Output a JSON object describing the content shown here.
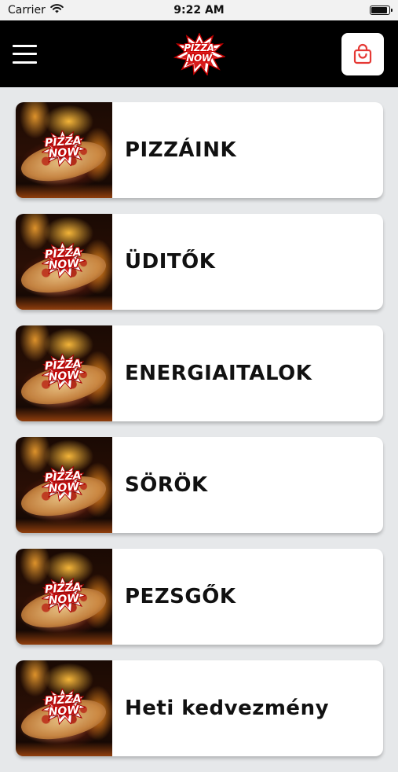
{
  "status_bar": {
    "carrier": "Carrier",
    "time": "9:22 AM"
  },
  "header": {
    "menu_icon": "hamburger-icon",
    "logo_line1": "PIZZA",
    "logo_line2": "NOW",
    "cart_icon": "shopping-bag-icon"
  },
  "colors": {
    "header_bg": "#000000",
    "accent": "#e53935",
    "page_bg": "#e6e8ea",
    "card_bg": "#ffffff"
  },
  "categories": [
    {
      "label": "PIZZÁINK",
      "badge_line1": "PIZZA",
      "badge_line2": "NOW"
    },
    {
      "label": "ÜDITŐK",
      "badge_line1": "PIZZA",
      "badge_line2": "NOW"
    },
    {
      "label": "ENERGIAITALOK",
      "badge_line1": "PIZZA",
      "badge_line2": "NOW"
    },
    {
      "label": "SÖRÖK",
      "badge_line1": "PIZZA",
      "badge_line2": "NOW"
    },
    {
      "label": "PEZSGŐK",
      "badge_line1": "PIZZA",
      "badge_line2": "NOW"
    },
    {
      "label": "Heti kedvezmény",
      "badge_line1": "PIZZA",
      "badge_line2": "NOW"
    }
  ]
}
